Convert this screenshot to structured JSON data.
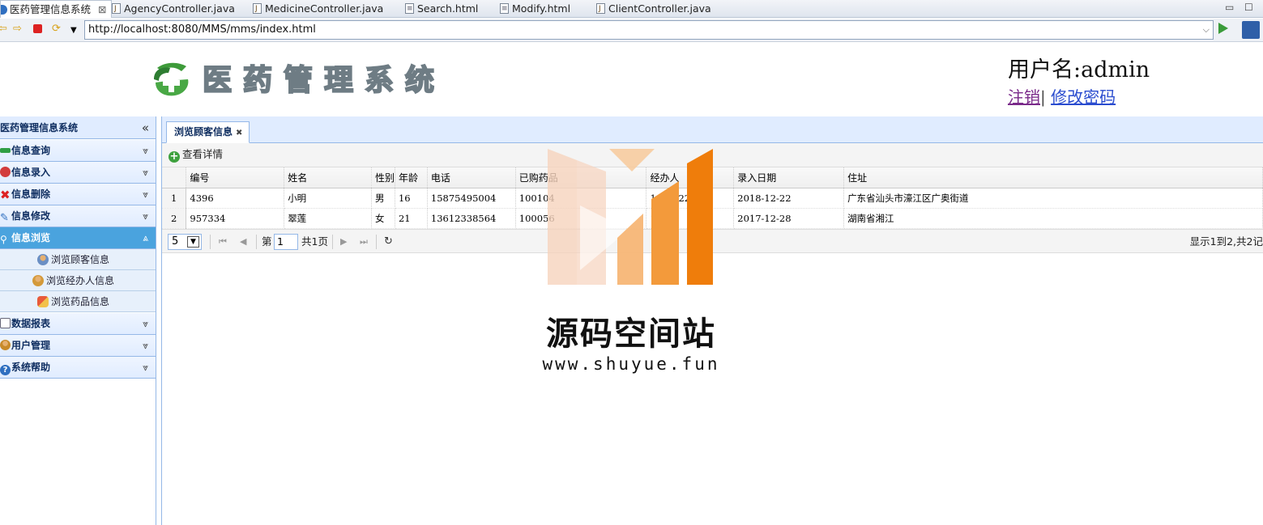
{
  "eclipse_tabs": [
    {
      "label": "医药管理信息系统",
      "active": true,
      "icon": "browser-icon"
    },
    {
      "label": "AgencyController.java",
      "icon": "java-file-icon"
    },
    {
      "label": "MedicineController.java",
      "icon": "java-file-icon"
    },
    {
      "label": "Search.html",
      "icon": "html-file-icon"
    },
    {
      "label": "Modify.html",
      "icon": "html-file-icon"
    },
    {
      "label": "ClientController.java",
      "icon": "java-file-icon"
    }
  ],
  "browser": {
    "url": "http://localhost:8080/MMS/mms/index.html"
  },
  "header": {
    "logo_text": "医药管理系统",
    "user_label": "用户名:admin",
    "logout": "注销",
    "separator": "|",
    "change_password": "修改密码"
  },
  "sidebar": {
    "title": "医药管理信息系统",
    "sections": [
      {
        "label": "信息查询",
        "icon": "query-icon",
        "color": "#2f9e44"
      },
      {
        "label": "信息录入",
        "icon": "entry-icon",
        "color": "#d23c3c"
      },
      {
        "label": "信息删除",
        "icon": "delete-icon",
        "color": "#d22"
      },
      {
        "label": "信息修改",
        "icon": "edit-icon",
        "color": "#2f6fc0"
      },
      {
        "label": "信息浏览",
        "icon": "search-icon",
        "color": "#ffffff",
        "selected": true
      },
      {
        "label": "数据报表",
        "icon": "report-icon",
        "color": "#667"
      },
      {
        "label": "用户管理",
        "icon": "user-icon",
        "color": "#c88a2a"
      },
      {
        "label": "系统帮助",
        "icon": "help-icon",
        "color": "#2f6fc0"
      }
    ],
    "browse_items": [
      {
        "label": "浏览顾客信息",
        "icon": "customer-icon"
      },
      {
        "label": "浏览经办人信息",
        "icon": "agent-icon"
      },
      {
        "label": "浏览药品信息",
        "icon": "medicine-icon"
      }
    ]
  },
  "panel": {
    "tab_label": "浏览顾客信息",
    "toolbar_button": "查看详情",
    "columns": [
      "编号",
      "姓名",
      "性别",
      "年龄",
      "电话",
      "已购药品",
      "经办人",
      "录入日期",
      "住址"
    ],
    "rows": [
      {
        "rn": "1",
        "id": "4396",
        "name": "小明",
        "gender": "男",
        "age": "16",
        "phone": "15875495004",
        "medicine": "100104",
        "agent": "1007_22",
        "date": "2018-12-22",
        "address": "广东省汕头市濠江区广奥街道"
      },
      {
        "rn": "2",
        "id": "957334",
        "name": "翠莲",
        "gender": "女",
        "age": "21",
        "phone": "13612338564",
        "medicine": "100056",
        "agent": "1_35",
        "date": "2017-12-28",
        "address": "湖南省湘江"
      }
    ],
    "pager": {
      "page_size": "5",
      "page_prefix": "第",
      "page_value": "1",
      "page_suffix": "共1页",
      "info": "显示1到2,共2记"
    }
  },
  "watermark": {
    "name": "源码空间站",
    "url": "www.shuyue.fun",
    "colors": [
      "#f6d3bd",
      "#f7b676",
      "#f39a3b",
      "#ef7d0b"
    ]
  }
}
